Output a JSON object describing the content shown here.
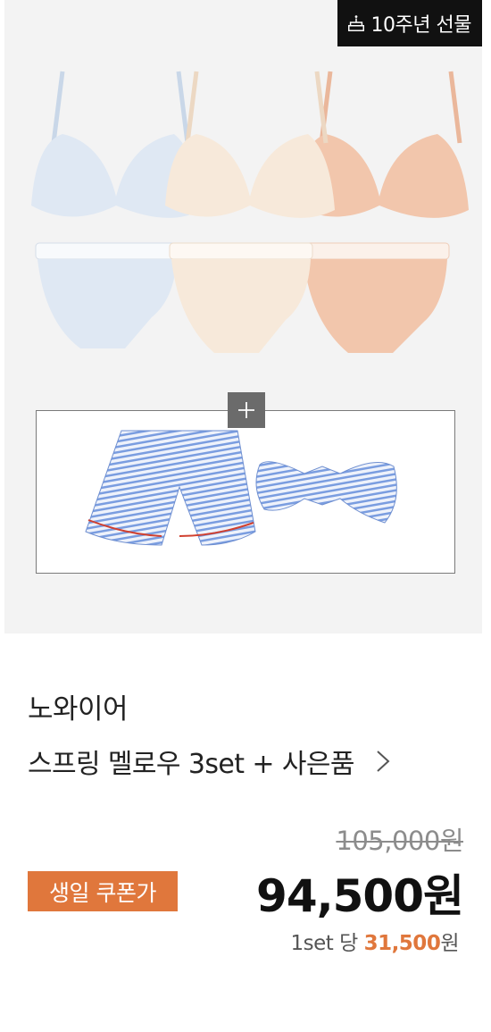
{
  "badge": {
    "label": "10주년 선물",
    "icon": "cake-icon"
  },
  "gift_plus": "+",
  "brand": "노와이어",
  "product_title": "스프링 멜로우 3set + 사은품",
  "original_price": "105,000원",
  "coupon_label": "생일 쿠폰가",
  "sale_price": "94,500원",
  "per_set": {
    "prefix": "1set 당 ",
    "amount": "31,500",
    "suffix": "원"
  },
  "colors": {
    "accent": "#e0773c",
    "badge_bg": "#111111",
    "hero_bg": "#f3f3f3",
    "set_blue": "#dfe8f3",
    "set_cream": "#f7e9da",
    "set_peach": "#f2c6ac",
    "stripe": "#7a9de0"
  }
}
